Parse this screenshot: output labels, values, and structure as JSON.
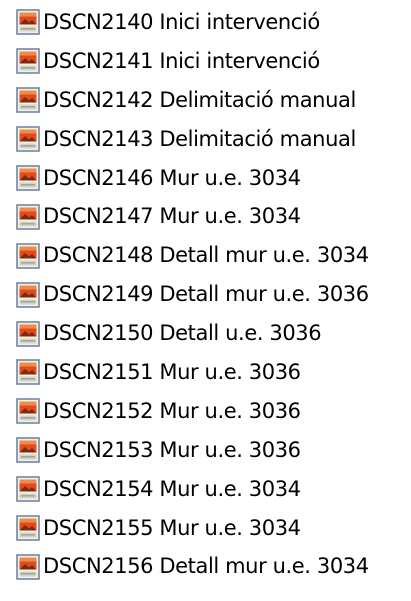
{
  "file_list": {
    "icon": "image-file-icon",
    "items": [
      {
        "label": "DSCN2140 Inici intervenció"
      },
      {
        "label": "DSCN2141 Inici intervenció"
      },
      {
        "label": "DSCN2142 Delimitació manual"
      },
      {
        "label": "DSCN2143 Delimitació manual"
      },
      {
        "label": "DSCN2146 Mur u.e. 3034"
      },
      {
        "label": "DSCN2147 Mur u.e. 3034"
      },
      {
        "label": "DSCN2148 Detall mur u.e. 3034"
      },
      {
        "label": "DSCN2149 Detall mur u.e. 3036"
      },
      {
        "label": "DSCN2150 Detall u.e. 3036"
      },
      {
        "label": "DSCN2151 Mur u.e. 3036"
      },
      {
        "label": "DSCN2152 Mur u.e. 3036"
      },
      {
        "label": "DSCN2153 Mur u.e. 3036"
      },
      {
        "label": "DSCN2154 Mur u.e. 3034"
      },
      {
        "label": "DSCN2155 Mur u.e. 3034"
      },
      {
        "label": "DSCN2156 Detall mur u.e. 3034"
      }
    ]
  }
}
